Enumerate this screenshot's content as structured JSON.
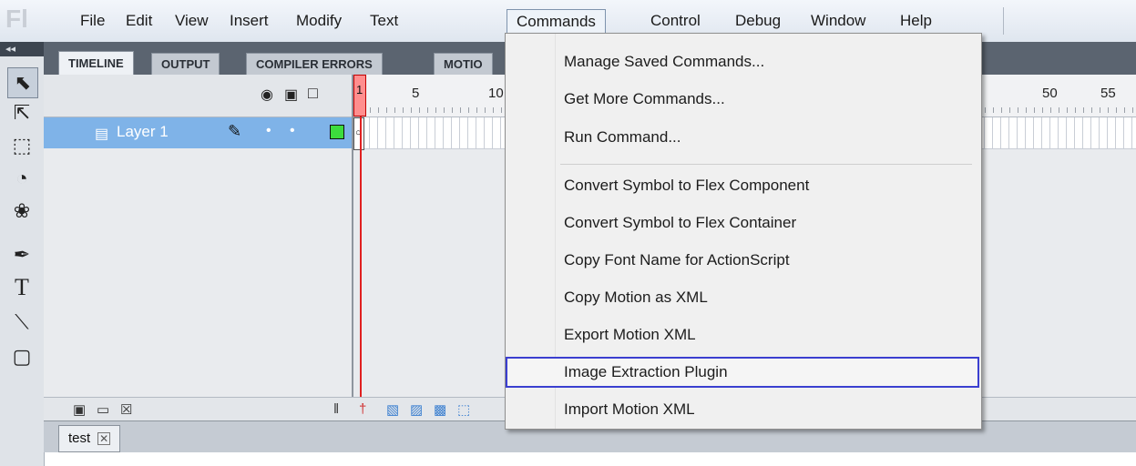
{
  "app": {
    "logo_text": "Fl"
  },
  "menubar": {
    "items": [
      "File",
      "Edit",
      "View",
      "Insert",
      "Modify",
      "Text",
      "Commands",
      "Control",
      "Debug",
      "Window",
      "Help"
    ],
    "active": "Commands"
  },
  "panel": {
    "collapse_glyph": "◂◂",
    "tabs": [
      "TIMELINE",
      "OUTPUT",
      "COMPILER ERRORS",
      "MOTIO"
    ]
  },
  "timeline": {
    "ruler_labels": [
      "1",
      "5",
      "10",
      "50",
      "55"
    ],
    "layer": {
      "name": "Layer 1",
      "outline_color": "#3ddc3d"
    }
  },
  "document": {
    "tab_label": "test"
  },
  "commands_menu": {
    "groups": [
      [
        "Manage Saved Commands...",
        "Get More Commands...",
        "Run Command..."
      ],
      [
        "Convert Symbol to Flex Component",
        "Convert Symbol to Flex Container",
        "Copy Font Name for ActionScript",
        "Copy Motion as XML",
        "Export Motion XML",
        "Image Extraction Plugin",
        "Import Motion XML"
      ]
    ],
    "highlighted": "Image Extraction Plugin",
    "highlight_color": "#3b3fd0"
  },
  "tools": [
    "selection-tool",
    "subselection-tool",
    "free-transform-tool",
    "3d-rotation-tool",
    "lasso-tool",
    "pen-tool",
    "text-tool",
    "line-tool",
    "rectangle-tool"
  ]
}
